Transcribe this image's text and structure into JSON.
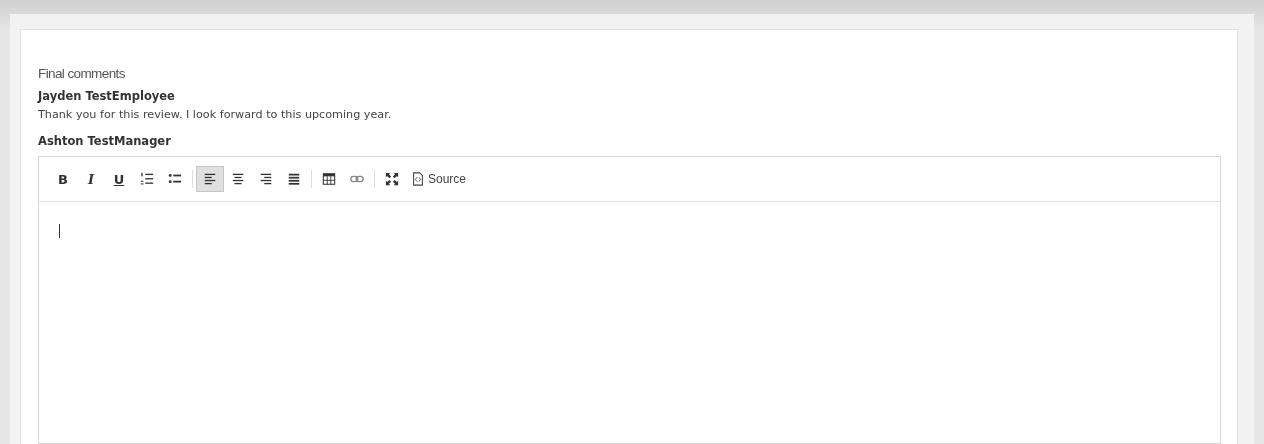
{
  "section_title": "Final comments",
  "comments": [
    {
      "author": "Jayden TestEmployee",
      "text": "Thank you for this review. I look forward to this upcoming year."
    }
  ],
  "editor": {
    "author": "Ashton TestManager",
    "toolbar": [
      [
        {
          "kind": "bold",
          "label": "B",
          "selected": false
        },
        {
          "kind": "italic",
          "label": "I",
          "selected": false
        },
        {
          "kind": "underline",
          "label": "U",
          "selected": false
        },
        {
          "kind": "numbered-list",
          "selected": false
        },
        {
          "kind": "bullet-list",
          "selected": false
        }
      ],
      [
        {
          "kind": "align-left",
          "selected": true
        },
        {
          "kind": "align-center",
          "selected": false
        },
        {
          "kind": "align-right",
          "selected": false
        },
        {
          "kind": "justify",
          "selected": false
        }
      ],
      [
        {
          "kind": "table",
          "selected": false
        },
        {
          "kind": "link",
          "selected": false
        }
      ],
      [
        {
          "kind": "maximize",
          "selected": false
        },
        {
          "kind": "source",
          "label": "Source",
          "selected": false
        }
      ]
    ]
  }
}
